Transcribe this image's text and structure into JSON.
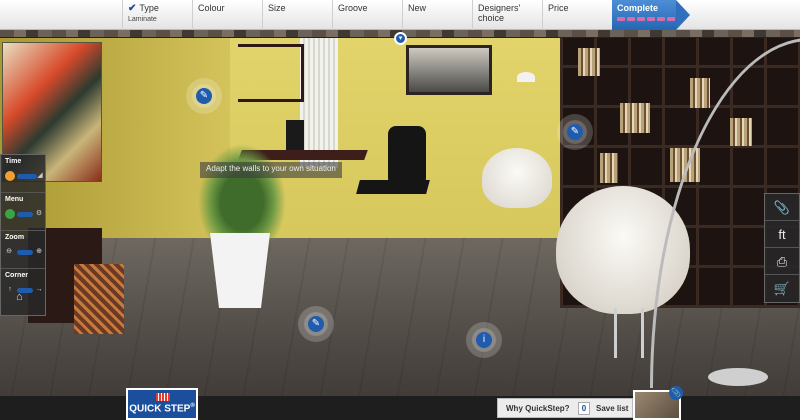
{
  "steps": [
    {
      "label": "Type",
      "sub": "Laminate",
      "checked": true
    },
    {
      "label": "Colour"
    },
    {
      "label": "Size"
    },
    {
      "label": "Groove"
    },
    {
      "label": "New"
    },
    {
      "label": "Designers' choice"
    },
    {
      "label": "Price"
    },
    {
      "label": "Complete",
      "progress_dots": 6
    }
  ],
  "hint": "Adapt the walls to your own situation",
  "left_panel": {
    "time_label": "Time",
    "menu_label": "Menu",
    "zoom_label": "Zoom",
    "corner_label": "Corner"
  },
  "bottom": {
    "logo": "QUICK STEP",
    "logo_reg": "®",
    "why_label": "Why QuickStep?",
    "save_count": "0",
    "save_label": "Save list"
  },
  "icons": {
    "check": "✔",
    "pencil": "✎",
    "info": "i",
    "paperclip": "📎",
    "facebook": "f",
    "twitter": "t",
    "print": "⎙",
    "cart": "🛒",
    "house": "⌂",
    "chevron": "▾"
  }
}
